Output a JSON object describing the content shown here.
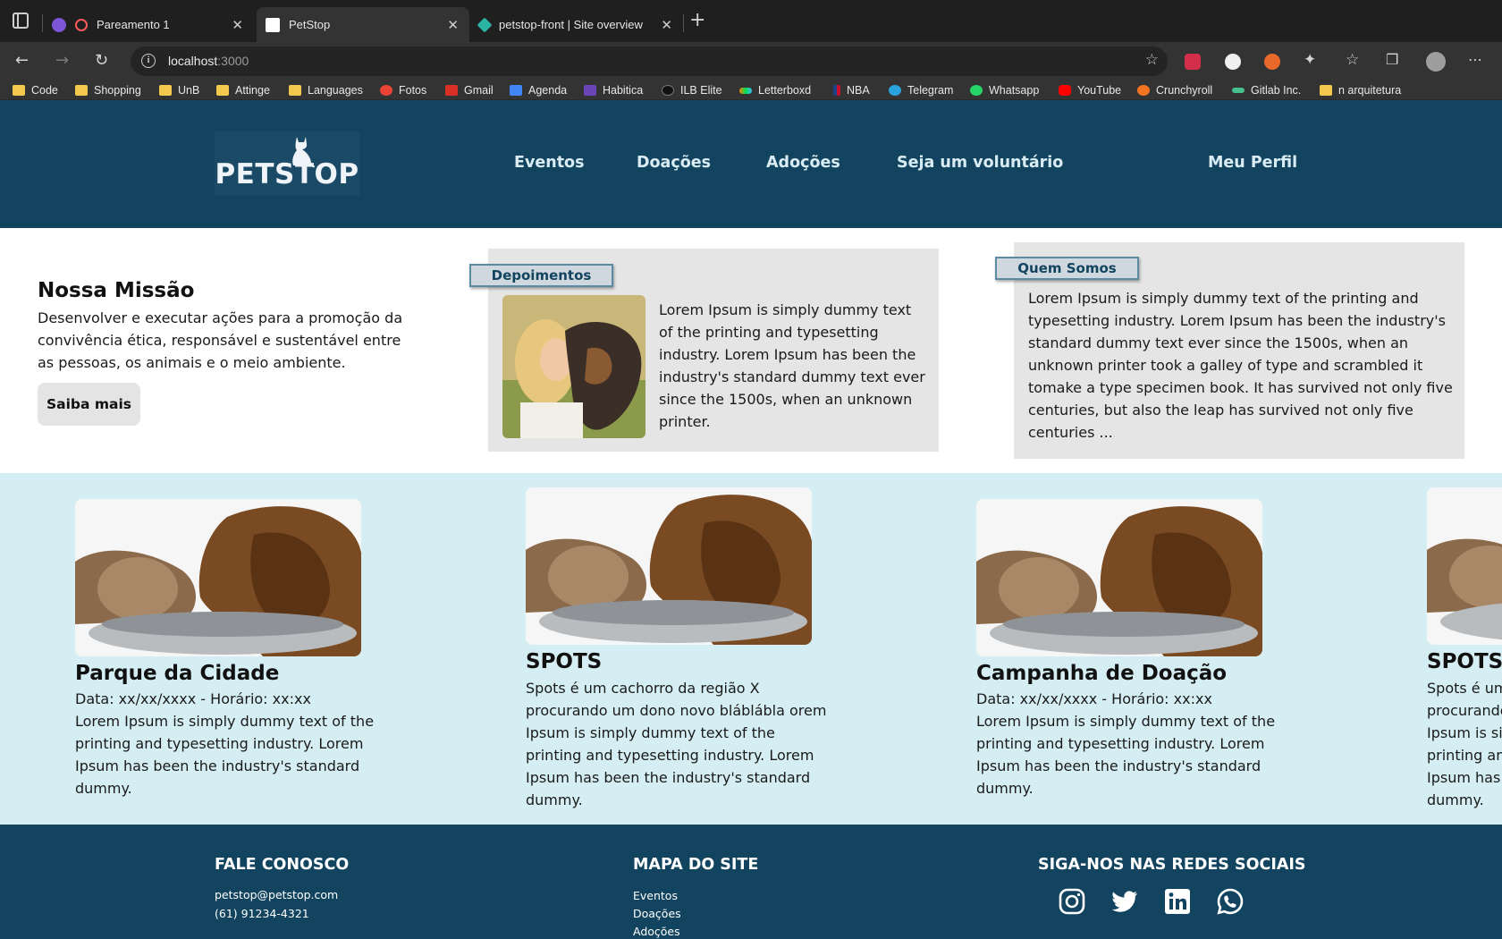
{
  "browser": {
    "tabs": [
      {
        "title": "Pareamento 1"
      },
      {
        "title": "PetStop"
      },
      {
        "title": "petstop-front | Site overview"
      }
    ],
    "url": {
      "host": "localhost",
      "port": ":3000"
    },
    "bookmarks": [
      "Code",
      "Shopping",
      "UnB",
      "Attinge",
      "Languages",
      "Fotos",
      "Gmail",
      "Agenda",
      "Habitica",
      "ILB Elite",
      "Letterboxd",
      "NBA",
      "Telegram",
      "Whatsapp",
      "YouTube",
      "Crunchyroll",
      "Gitlab Inc.",
      "n arquitetura"
    ]
  },
  "header": {
    "logo_text": "PETSTOP",
    "nav": [
      "Eventos",
      "Doações",
      "Adoções",
      "Seja um voluntário"
    ],
    "profile": "Meu Perfil"
  },
  "mission": {
    "title": "Nossa Missão",
    "text": "Desenvolver e executar ações para a promoção da convivência ética, responsável e sustentável entre as pessoas, os animais e o meio ambiente.",
    "button": "Saiba mais"
  },
  "testimonials": {
    "tag": "Depoimentos",
    "text": "Lorem Ipsum is simply dummy text of the printing and typesetting industry. Lorem Ipsum has been the industry's standard dummy text ever since the 1500s, when an unknown printer."
  },
  "about": {
    "tag": "Quem Somos",
    "text": "Lorem Ipsum is simply dummy text of the printing and typesetting industry. Lorem Ipsum has been the industry's standard dummy text ever since the 1500s, when an unknown printer took a galley of type and scrambled it tomake a type specimen book. It has survived not only five centuries, but also the leap has survived not only five centuries ..."
  },
  "cards": [
    {
      "title": "Parque da Cidade",
      "date": "Data: xx/xx/xxxx - Horário: xx:xx",
      "text": "Lorem Ipsum is simply dummy text of the printing and typesetting industry. Lorem Ipsum has been the industry's standard dummy."
    },
    {
      "title": "SPOTS",
      "date": "",
      "text": "Spots é um cachorro da região X procurando um dono novo bláblábla orem Ipsum is simply dummy text of the printing and typesetting industry. Lorem Ipsum has been the industry's standard dummy."
    },
    {
      "title": "Campanha de Doação",
      "date": "Data: xx/xx/xxxx - Horário: xx:xx",
      "text": "Lorem Ipsum is simply dummy text of the printing and typesetting industry. Lorem Ipsum has been the industry's standard dummy."
    },
    {
      "title": "SPOTS",
      "date": "",
      "text": "Spots é um cachorro da região X procurando um dono novo bláblábla orem Ipsum is simply dummy text of the printing and typesetting industry. Lorem Ipsum has been the industry's standard dummy."
    }
  ],
  "footer": {
    "contact": {
      "title": "FALE CONOSCO",
      "email": "petstop@petstop.com",
      "phone": "(61) 91234-4321"
    },
    "sitemap": {
      "title": "MAPA DO SITE",
      "links": [
        "Eventos",
        "Doações",
        "Adoções"
      ]
    },
    "social": {
      "title": "SIGA-NOS NAS REDES SOCIAIS",
      "icons": [
        "instagram-icon",
        "twitter-icon",
        "linkedin-icon",
        "whatsapp-icon"
      ]
    }
  },
  "colors": {
    "brand": "#124460",
    "cards_bg": "#d5eef3",
    "panel_bg": "#e5e5e5"
  }
}
